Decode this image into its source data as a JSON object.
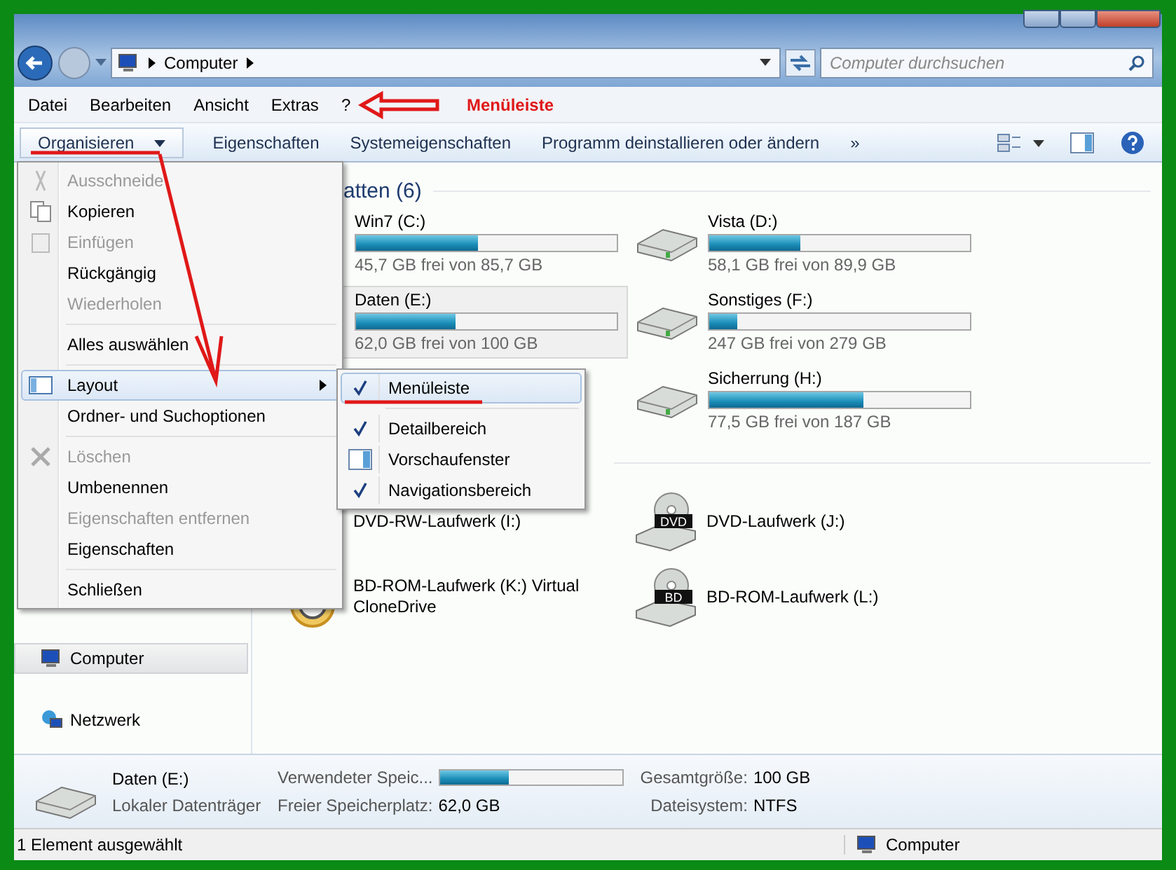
{
  "address": {
    "path": "Computer",
    "search_placeholder": "Computer durchsuchen"
  },
  "menu_bar": [
    "Datei",
    "Bearbeiten",
    "Ansicht",
    "Extras",
    "?"
  ],
  "toolbar": {
    "organize": "Organisieren",
    "buttons": [
      "Eigenschaften",
      "Systemeigenschaften",
      "Programm deinstallieren oder ändern"
    ],
    "more": "»"
  },
  "nav_pane": [
    {
      "label": "Computer",
      "kind": "computer",
      "selected": true
    },
    {
      "label": "Netzwerk",
      "kind": "network",
      "selected": false
    }
  ],
  "hard_drives": {
    "header": "atten (6)",
    "columns": [
      [
        {
          "name": "Win7 (C:)",
          "free": "45,7 GB frei von 85,7 GB",
          "level": 0.47,
          "selected": false
        },
        {
          "name": "Daten (E:)",
          "free": "62,0 GB frei von 100 GB",
          "level": 0.38,
          "selected": true
        }
      ],
      [
        {
          "name": "Vista (D:)",
          "free": "58,1 GB frei von 89,9 GB",
          "level": 0.35,
          "selected": false,
          "kind": "hdd"
        },
        {
          "name": "Sonstiges (F:)",
          "free": "247 GB frei von 279 GB",
          "level": 0.11,
          "selected": false,
          "kind": "hdd"
        },
        {
          "name": "Sicherrung (H:)",
          "free": "77,5 GB frei von 187 GB",
          "level": 0.59,
          "selected": false,
          "kind": "hdd"
        }
      ]
    ]
  },
  "removable": {
    "columns": [
      [
        {
          "name": "DVD-RW-Laufwerk (I:)"
        },
        {
          "name": "BD-ROM-Laufwerk (K:) Virtual CloneDrive",
          "kind": "clonedrive"
        }
      ],
      [
        {
          "name": "DVD-Laufwerk (J:)",
          "kind": "dvd",
          "badge": "DVD"
        },
        {
          "name": "BD-ROM-Laufwerk (L:)",
          "kind": "bd",
          "badge": "BD"
        }
      ]
    ]
  },
  "menu": [
    {
      "kind": "cut",
      "label": "Ausschneide",
      "disabled": true,
      "selected": false
    },
    {
      "kind": "copy",
      "label": "Kopieren",
      "disabled": false,
      "selected": false
    },
    {
      "kind": "paste",
      "label": "Einfügen",
      "disabled": true,
      "selected": false
    },
    {
      "kind": "item",
      "label": "Rückgängig",
      "disabled": false,
      "selected": false
    },
    {
      "kind": "item",
      "label": "Wiederholen",
      "disabled": true,
      "selected": false
    },
    {
      "kind": "separator"
    },
    {
      "kind": "item",
      "label": "Alles auswählen",
      "disabled": false,
      "selected": false
    },
    {
      "kind": "separator"
    },
    {
      "kind": "layout",
      "label": "Layout",
      "disabled": false,
      "selected": true
    },
    {
      "kind": "item",
      "label": "Ordner- und Suchoptionen",
      "disabled": false,
      "selected": false
    },
    {
      "kind": "separator"
    },
    {
      "kind": "delete",
      "label": "Löschen",
      "disabled": true,
      "selected": false
    },
    {
      "kind": "item",
      "label": "Umbenennen",
      "disabled": false,
      "selected": false
    },
    {
      "kind": "item",
      "label": "Eigenschaften entfernen",
      "disabled": true,
      "selected": false
    },
    {
      "kind": "item",
      "label": "Eigenschaften",
      "disabled": false,
      "selected": false
    },
    {
      "kind": "separator"
    },
    {
      "kind": "item",
      "label": "Schließen",
      "disabled": false,
      "selected": false
    }
  ],
  "submenu": [
    {
      "kind": "item",
      "label": "Menüleiste",
      "checked": true,
      "selected": true
    },
    {
      "kind": "separator"
    },
    {
      "kind": "item",
      "label": "Detailbereich",
      "checked": true,
      "selected": false
    },
    {
      "kind": "preview",
      "label": "Vorschaufenster",
      "checked": false,
      "selected": false
    },
    {
      "kind": "item",
      "label": "Navigationsbereich",
      "checked": true,
      "selected": false
    }
  ],
  "details": {
    "name": "Daten (E:)",
    "type": "Lokaler Datenträger",
    "used_label": "Verwendeter Speic...",
    "level": 0.38,
    "free_label": "Freier Speicherplatz:",
    "free_value": "62,0 GB",
    "total_label": "Gesamtgröße:",
    "total_value": "100 GB",
    "fs_label": "Dateisystem:",
    "fs_value": "NTFS"
  },
  "status_bar": {
    "text": "1 Element ausgewählt",
    "location": "Computer"
  },
  "annotation": {
    "label": "Menüleiste"
  }
}
